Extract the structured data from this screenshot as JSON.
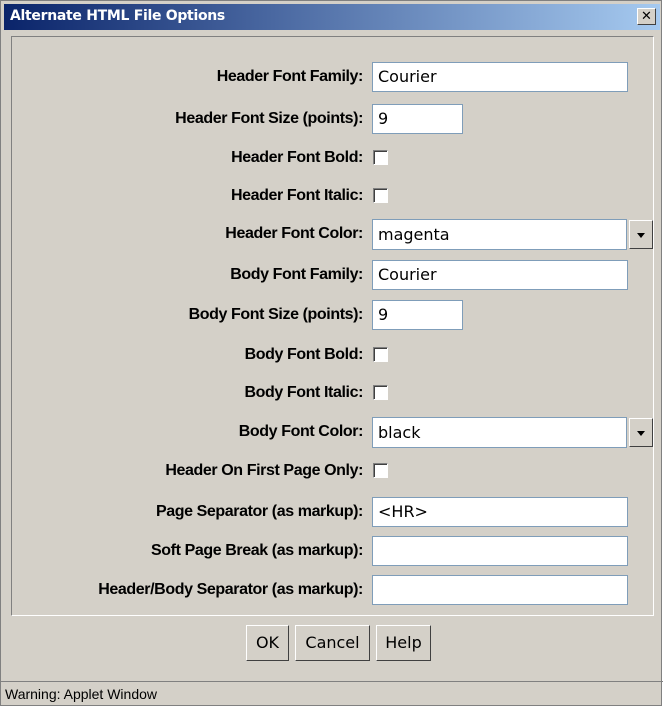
{
  "window": {
    "title": "Alternate HTML File Options",
    "close_glyph": "✕"
  },
  "fields": {
    "header_font_family": {
      "label": "Header Font Family:",
      "value": "Courier"
    },
    "header_font_size": {
      "label": "Header Font Size (points):",
      "value": "9"
    },
    "header_font_bold": {
      "label": "Header Font Bold:",
      "checked": false
    },
    "header_font_italic": {
      "label": "Header Font Italic:",
      "checked": false
    },
    "header_font_color": {
      "label": "Header Font Color:",
      "value": "magenta"
    },
    "body_font_family": {
      "label": "Body Font Family:",
      "value": "Courier"
    },
    "body_font_size": {
      "label": "Body Font Size (points):",
      "value": "9"
    },
    "body_font_bold": {
      "label": "Body Font Bold:",
      "checked": false
    },
    "body_font_italic": {
      "label": "Body Font Italic:",
      "checked": false
    },
    "body_font_color": {
      "label": "Body Font Color:",
      "value": "black"
    },
    "header_first_page_only": {
      "label": "Header On First Page Only:",
      "checked": false
    },
    "page_separator": {
      "label": "Page Separator (as markup):",
      "value": "<HR>"
    },
    "soft_page_break": {
      "label": "Soft Page Break (as markup):",
      "value": ""
    },
    "header_body_separator": {
      "label": "Header/Body Separator (as markup):",
      "value": ""
    }
  },
  "buttons": {
    "ok": "OK",
    "cancel": "Cancel",
    "help": "Help"
  },
  "status": {
    "text": "Warning: Applet Window"
  },
  "colors": {
    "window_bg": "#d4d0c8",
    "title_start": "#0a246a",
    "title_end": "#a6caf0"
  }
}
